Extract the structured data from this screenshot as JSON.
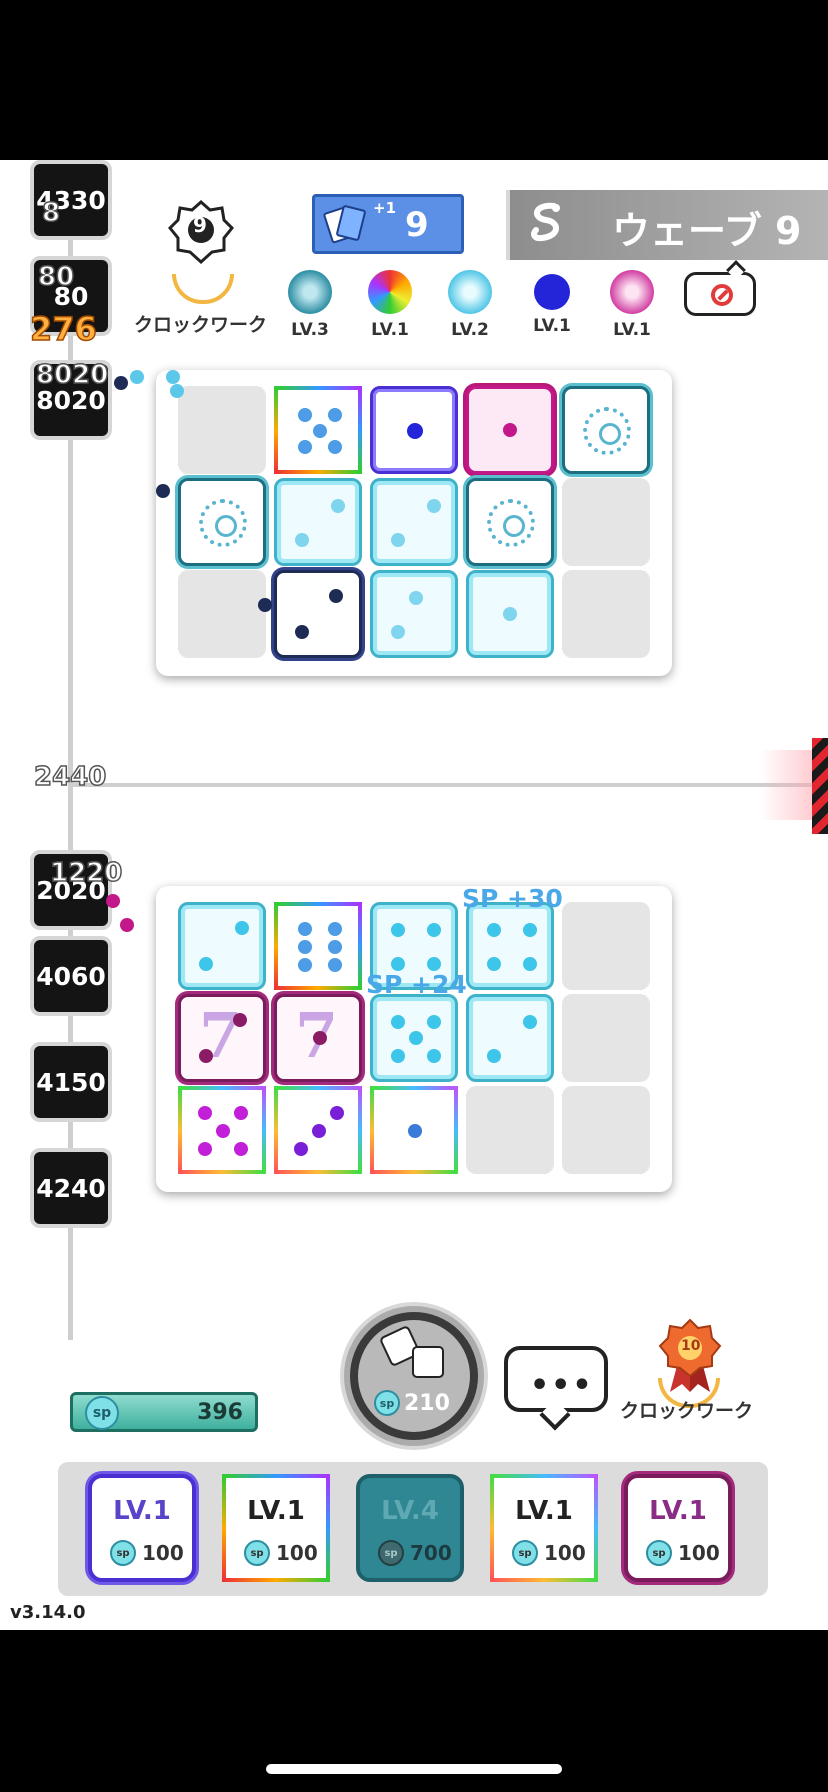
{
  "top": {
    "cards": {
      "plus": "+1",
      "count": "9"
    },
    "wave": {
      "text": "ウェーブ 9"
    }
  },
  "opponent": {
    "rank_number": "9",
    "rank_name": "クロックワーク",
    "deck": [
      {
        "icon": "teal-swirl-icon",
        "color": "#2d8ea3",
        "level": "LV.3"
      },
      {
        "icon": "rainbow-icon",
        "color": "#f29b2a",
        "level": "LV.1"
      },
      {
        "icon": "cyan-flame-icon",
        "color": "#4fc6e6",
        "level": "LV.2"
      },
      {
        "icon": "blue-dot-icon",
        "color": "#2424d8",
        "level": "LV.1"
      },
      {
        "icon": "pink-swirl-icon",
        "color": "#d13ea3",
        "level": "LV.1"
      }
    ],
    "emote": "no-emote-icon"
  },
  "enemies_opponent": [
    "4330",
    "80",
    "8020"
  ],
  "enemies_player": [
    "2020",
    "4060",
    "4150",
    "4240"
  ],
  "damage_numbers": {
    "top": [
      "8",
      "80",
      "276",
      "8020"
    ],
    "bottom": [
      "2440",
      "1220"
    ]
  },
  "sp_gains": [
    "SP +30",
    "SP +24"
  ],
  "player": {
    "rank_number": "10",
    "rank_name": "クロックワーク",
    "sp": "396",
    "spawn_cost": "210",
    "sp_coin": "sp",
    "chat_dots": "•••",
    "deck": [
      {
        "level": "LV.1",
        "cost": "100",
        "color": "#5a43c9"
      },
      {
        "level": "LV.1",
        "cost": "100",
        "color": "#222222"
      },
      {
        "level": "LV.4",
        "cost": "700",
        "color": "#2e8a97"
      },
      {
        "level": "LV.1",
        "cost": "100",
        "color": "#222222"
      },
      {
        "level": "LV.1",
        "cost": "100",
        "color": "#8a2b86"
      }
    ]
  },
  "version": "v3.14.0"
}
